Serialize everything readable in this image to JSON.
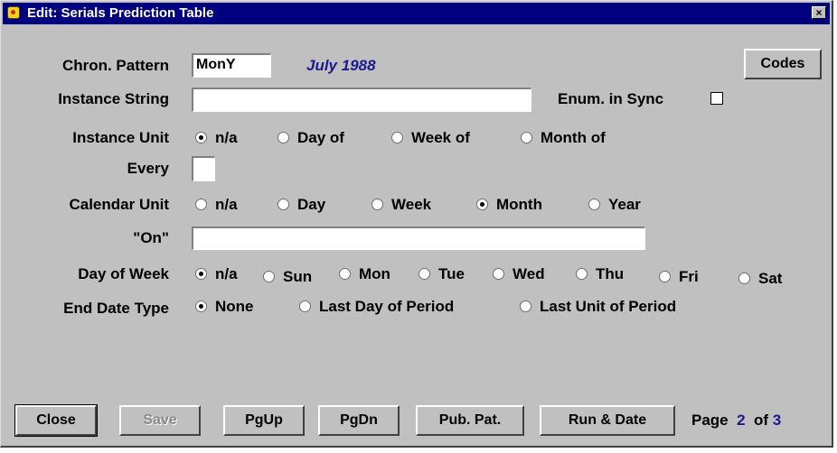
{
  "window": {
    "title": "Edit: Serials Prediction Table",
    "close_label": "×"
  },
  "chron_pattern": {
    "label": "Chron. Pattern",
    "value": "MonY",
    "display_date": "July 1988"
  },
  "codes_button": "Codes",
  "instance_string": {
    "label": "Instance String",
    "value": ""
  },
  "enum_in_sync": {
    "label": "Enum. in Sync",
    "checked": false
  },
  "instance_unit": {
    "label": "Instance Unit",
    "options": [
      "n/a",
      "Day of",
      "Week of",
      "Month of"
    ],
    "selected": "n/a"
  },
  "every": {
    "label": "Every",
    "value": ""
  },
  "calendar_unit": {
    "label": "Calendar Unit",
    "options": [
      "n/a",
      "Day",
      "Week",
      "Month",
      "Year"
    ],
    "selected": "Month"
  },
  "on": {
    "label": "\"On\"",
    "value": ""
  },
  "day_of_week": {
    "label": "Day of Week",
    "options": [
      "n/a",
      "Sun",
      "Mon",
      "Tue",
      "Wed",
      "Thu",
      "Fri",
      "Sat"
    ],
    "selected": "n/a"
  },
  "end_date_type": {
    "label": "End Date Type",
    "options": [
      "None",
      "Last Day of Period",
      "Last Unit of Period"
    ],
    "selected": "None"
  },
  "buttons": {
    "close": "Close",
    "save": "Save",
    "pgup": "PgUp",
    "pgdn": "PgDn",
    "pub_pat": "Pub. Pat.",
    "run_date": "Run & Date"
  },
  "pager": {
    "page_label": "Page",
    "current": "2",
    "of_label": "of",
    "total": "3"
  }
}
